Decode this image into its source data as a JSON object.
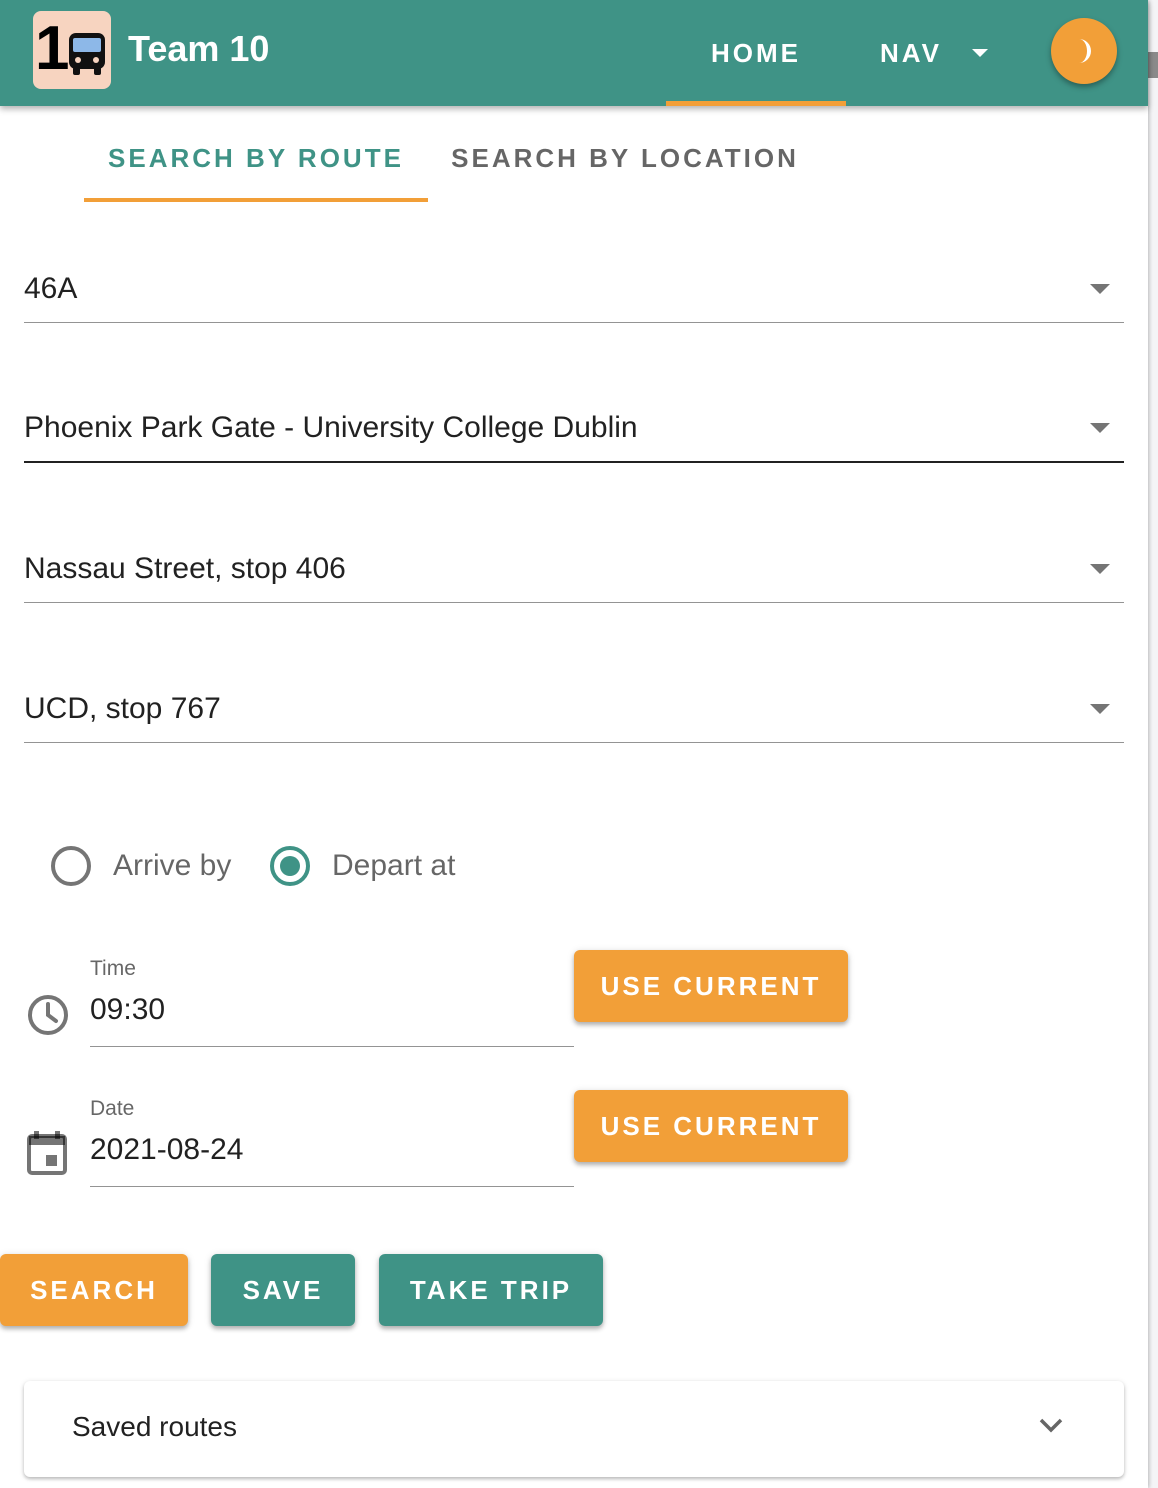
{
  "app": {
    "logo_text": "1",
    "title": "Team 10"
  },
  "nav": {
    "home_label": "HOME",
    "nav_label": "NAV",
    "theme_icon": "moon-icon"
  },
  "tabs": [
    {
      "label": "SEARCH BY ROUTE",
      "active": true
    },
    {
      "label": "SEARCH BY LOCATION",
      "active": false
    }
  ],
  "form": {
    "route": "46A",
    "direction": "Phoenix Park Gate - University College Dublin",
    "from_stop": "Nassau Street, stop 406",
    "to_stop": "UCD, stop 767",
    "radio_arrive": "Arrive by",
    "radio_depart": "Depart at",
    "selected_radio": "Depart at",
    "time_label": "Time",
    "time_value": "09:30",
    "date_label": "Date",
    "date_value": "2021-08-24",
    "use_current_label": "USE CURRENT"
  },
  "actions": {
    "search": "SEARCH",
    "save": "SAVE",
    "take_trip": "TAKE TRIP"
  },
  "saved_routes": {
    "title": "Saved routes"
  },
  "colors": {
    "primary": "#3f9386",
    "accent": "#f29f38"
  }
}
